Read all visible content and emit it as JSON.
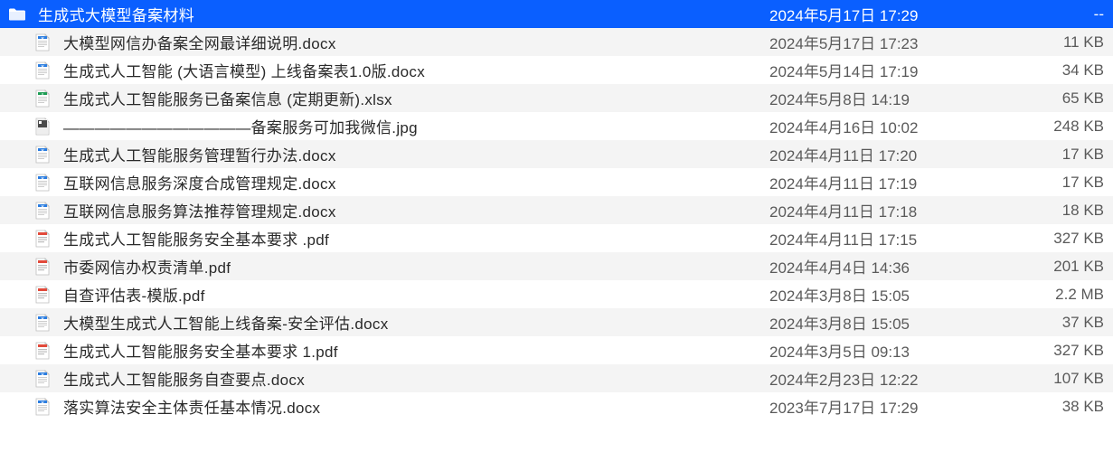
{
  "files": [
    {
      "icon": "folder",
      "name": "生成式大模型备案材料",
      "date": "2024年5月17日 17:29",
      "size": "--",
      "selected": true,
      "indent": false
    },
    {
      "icon": "docx",
      "name": "大模型网信办备案全网最详细说明.docx",
      "date": "2024年5月17日 17:23",
      "size": "11 KB",
      "selected": false,
      "indent": true
    },
    {
      "icon": "docx",
      "name": "生成式人工智能 (大语言模型) 上线备案表1.0版.docx",
      "date": "2024年5月14日 17:19",
      "size": "34 KB",
      "selected": false,
      "indent": true
    },
    {
      "icon": "xlsx",
      "name": "生成式人工智能服务已备案信息 (定期更新).xlsx",
      "date": "2024年5月8日 14:19",
      "size": "65 KB",
      "selected": false,
      "indent": true
    },
    {
      "icon": "jpg",
      "name": "————————————备案服务可加我微信.jpg",
      "date": "2024年4月16日 10:02",
      "size": "248 KB",
      "selected": false,
      "indent": true
    },
    {
      "icon": "docx",
      "name": "生成式人工智能服务管理暂行办法.docx",
      "date": "2024年4月11日 17:20",
      "size": "17 KB",
      "selected": false,
      "indent": true
    },
    {
      "icon": "docx",
      "name": "互联网信息服务深度合成管理规定.docx",
      "date": "2024年4月11日 17:19",
      "size": "17 KB",
      "selected": false,
      "indent": true
    },
    {
      "icon": "docx",
      "name": "互联网信息服务算法推荐管理规定.docx",
      "date": "2024年4月11日 17:18",
      "size": "18 KB",
      "selected": false,
      "indent": true
    },
    {
      "icon": "pdf",
      "name": "生成式人工智能服务安全基本要求 .pdf",
      "date": "2024年4月11日 17:15",
      "size": "327 KB",
      "selected": false,
      "indent": true
    },
    {
      "icon": "pdf",
      "name": "市委网信办权责清单.pdf",
      "date": "2024年4月4日 14:36",
      "size": "201 KB",
      "selected": false,
      "indent": true
    },
    {
      "icon": "pdf",
      "name": "自查评估表-模版.pdf",
      "date": "2024年3月8日 15:05",
      "size": "2.2 MB",
      "selected": false,
      "indent": true
    },
    {
      "icon": "docx",
      "name": "大模型生成式人工智能上线备案-安全评估.docx",
      "date": "2024年3月8日 15:05",
      "size": "37 KB",
      "selected": false,
      "indent": true
    },
    {
      "icon": "pdf",
      "name": "生成式人工智能服务安全基本要求  1.pdf",
      "date": "2024年3月5日 09:13",
      "size": "327 KB",
      "selected": false,
      "indent": true
    },
    {
      "icon": "docx",
      "name": "生成式人工智能服务自查要点.docx",
      "date": "2024年2月23日 12:22",
      "size": "107 KB",
      "selected": false,
      "indent": true
    },
    {
      "icon": "docx",
      "name": "落实算法安全主体责任基本情况.docx",
      "date": "2023年7月17日 17:29",
      "size": "38 KB",
      "selected": false,
      "indent": true
    }
  ],
  "icons": {
    "folder": "folder-icon",
    "docx": "docx-file-icon",
    "xlsx": "xlsx-file-icon",
    "jpg": "jpg-file-icon",
    "pdf": "pdf-file-icon"
  }
}
